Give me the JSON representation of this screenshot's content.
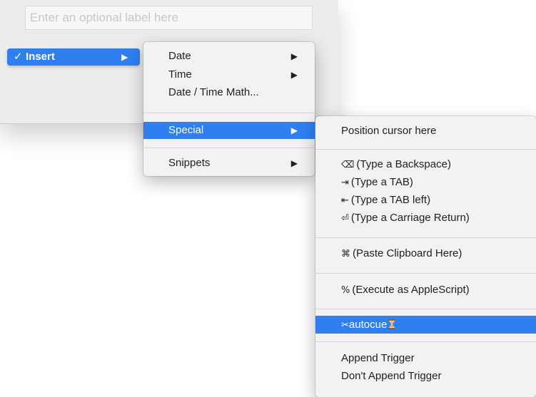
{
  "label_field": {
    "placeholder": "Enter an optional label here"
  },
  "insert_item": {
    "check": "✓",
    "label": "Insert",
    "arrow": "▶"
  },
  "insert_menu": {
    "items": [
      {
        "label": "Date",
        "arrow": "▶"
      },
      {
        "label": "Time",
        "arrow": "▶"
      },
      {
        "label": "Date / Time Math..."
      },
      {
        "label": "Special",
        "arrow": "▶",
        "selected": true
      },
      {
        "label": "Snippets",
        "arrow": "▶"
      }
    ]
  },
  "special_menu": {
    "items": [
      {
        "label": "Position cursor here"
      },
      {
        "glyph": "⌫",
        "label": "(Type a Backspace)"
      },
      {
        "glyph": "⇥",
        "label": "(Type a TAB)"
      },
      {
        "glyph": "⇤",
        "label": "(Type a TAB left)"
      },
      {
        "glyph": "⏎",
        "label": "(Type a Carriage Return)"
      },
      {
        "glyph": "⌘",
        "label": "(Paste Clipboard Here)"
      },
      {
        "glyph": "%",
        "label": "(Execute as AppleScript)"
      },
      {
        "glyph": "✂",
        "label": "autocue",
        "icon": "hourglass-icon",
        "selected": true
      },
      {
        "label": "Append Trigger"
      },
      {
        "label": "Don't Append Trigger"
      }
    ]
  },
  "colors": {
    "selection": "#2f7ff0",
    "menu_background": "#f2f2f2",
    "window_background": "#ececec"
  }
}
